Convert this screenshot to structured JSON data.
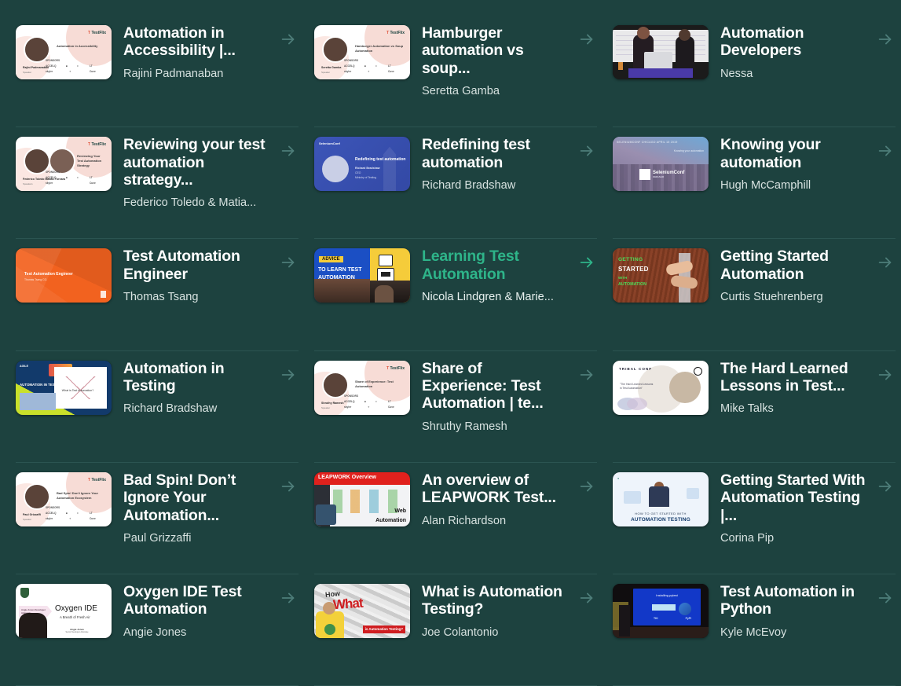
{
  "page": {
    "background_color": "#1d423f",
    "accent_color": "#2eb489",
    "divider_color": "#2b5451",
    "arrow_icon": "arrow-right-icon"
  },
  "cards": [
    {
      "title": "Automation in Accessibility |...",
      "author": "Rajini Padmanaban",
      "thumb_kind": "testflix-slide",
      "thumb_title": "Automation in Accessibility",
      "thumb_name": "Rajini Padmanaban",
      "brand": "TestFlix",
      "active": false
    },
    {
      "title": "Hamburger automation vs soup...",
      "author": "Seretta Gamba",
      "thumb_kind": "testflix-slide",
      "thumb_title": "Hamburger Automation vs Soup Automation",
      "thumb_name": "Seretta Gamba",
      "brand": "TestFlix",
      "active": false
    },
    {
      "title": "Automation Developers",
      "author": "Nessa",
      "thumb_kind": "conference-photo",
      "active": false
    },
    {
      "title": "Reviewing your test automation strategy...",
      "author": "Federico Toledo & Matia...",
      "thumb_kind": "testflix-slide-two-faces",
      "thumb_title": "Reviewing Your Test Automation Strategy",
      "thumb_name": "Federico Toledo   Matias Fornara",
      "brand": "TestFlix",
      "active": false
    },
    {
      "title": "Redefining test automation",
      "author": "Richard Bradshaw",
      "thumb_kind": "seleniumconf-slide",
      "thumb_title": "Redefining test automation",
      "thumb_line1": "Richard Bradshaw",
      "thumb_line2": "CEO",
      "thumb_line3": "Ministry of Testing",
      "brand": "SeleniumConf",
      "active": false
    },
    {
      "title": "Knowing your automation",
      "author": "Hugh McCamphill",
      "thumb_kind": "seleniumconf-chicago",
      "thumb_top": "SELENIUMCONF CHICAGO APRIL 15 2019",
      "thumb_right": "Knowing your automation",
      "brand": "SeleniumConf",
      "brand_sub": "CHICAGO",
      "active": false
    },
    {
      "title": "Test Automation Engineer",
      "author": "Thomas Tsang",
      "thumb_kind": "orange-slide",
      "thumb_title": "Test Automation Engineer",
      "thumb_sub": "Thomas Tsang   CO.",
      "active": false
    },
    {
      "title": "Learning Test Automation",
      "author": "Nicola Lindgren & Marie...",
      "thumb_kind": "advice-thumbnail",
      "thumb_badge": "ADVICE",
      "thumb_line1": "TO LEARN TEST",
      "thumb_line2": "AUTOMATION",
      "active": true
    },
    {
      "title": "Getting Started Automation",
      "author": "Curtis Stuehrenberg",
      "thumb_kind": "getting-started-thumbnail",
      "thumb_l1": "GETTING",
      "thumb_l2": "STARTED",
      "thumb_l3": "WITH",
      "thumb_l4": "AUTOMATION",
      "active": false
    },
    {
      "title": "Automation in Testing",
      "author": "Richard Bradshaw",
      "thumb_kind": "agile-slide",
      "thumb_title": "AUTOMATION IN TESTING",
      "thumb_caption": "What is Test Automation?",
      "brand": "AGILE",
      "active": false
    },
    {
      "title": "Share of Experience: Test Automation | te...",
      "author": "Shruthy Ramesh",
      "thumb_kind": "testflix-slide",
      "thumb_title": "Share of Experience: Test Automation",
      "thumb_name": "Shruthy Ramesh",
      "brand": "TestFlix",
      "active": false
    },
    {
      "title": "The Hard Learned Lessons in Test...",
      "author": "Mike Talks",
      "thumb_kind": "tribal-conf-slide",
      "thumb_title": "TRIBAL CONF",
      "thumb_line1": "\"The Hard Learned Lessons",
      "thumb_line2": "in Test Automation\"",
      "active": false
    },
    {
      "title": "Bad Spin! Don’t Ignore Your Automation...",
      "author": "Paul Grizzaffi",
      "thumb_kind": "testflix-slide",
      "thumb_title": "Bad Spin! Don't Ignore Your Automation Ecosystem",
      "thumb_name": "Paul Grizzaffi",
      "brand": "TestFlix",
      "active": false
    },
    {
      "title": "An overview of LEAPWORK Test...",
      "author": "Alan Richardson",
      "thumb_kind": "leapwork-thumbnail",
      "thumb_bar": "LEAPWORK Overview",
      "thumb_w1": "Web",
      "thumb_w2": "Automation",
      "active": false
    },
    {
      "title": "Getting Started With Automation Testing |...",
      "author": "Corina Pip",
      "thumb_kind": "get-started-testing-thumbnail",
      "thumb_t1": "HOW TO GET STARTED WITH",
      "thumb_t2": "AUTOMATION TESTING",
      "active": false
    },
    {
      "title": "Oxygen IDE Test Automation",
      "author": "Angie Jones",
      "thumb_kind": "oxygen-slide",
      "thumb_title": "Oxygen IDE",
      "thumb_sub": "A Breath of Fresh Air",
      "thumb_tag": "Angie Jones  Developer Advocate",
      "active": false
    },
    {
      "title": "What is Automation Testing?",
      "author": "Joe Colantonio",
      "thumb_kind": "what-thumbnail",
      "thumb_how": "How",
      "thumb_red": "What",
      "thumb_box": "is Automation Testing?",
      "active": false
    },
    {
      "title": "Test Automation in Python",
      "author": "Kyle McEvoy",
      "thumb_kind": "python-stage-photo",
      "thumb_screen_title": "Installing pytest",
      "thumb_label_left": "TKI",
      "thumb_label_right": "PyPI",
      "active": false
    }
  ]
}
